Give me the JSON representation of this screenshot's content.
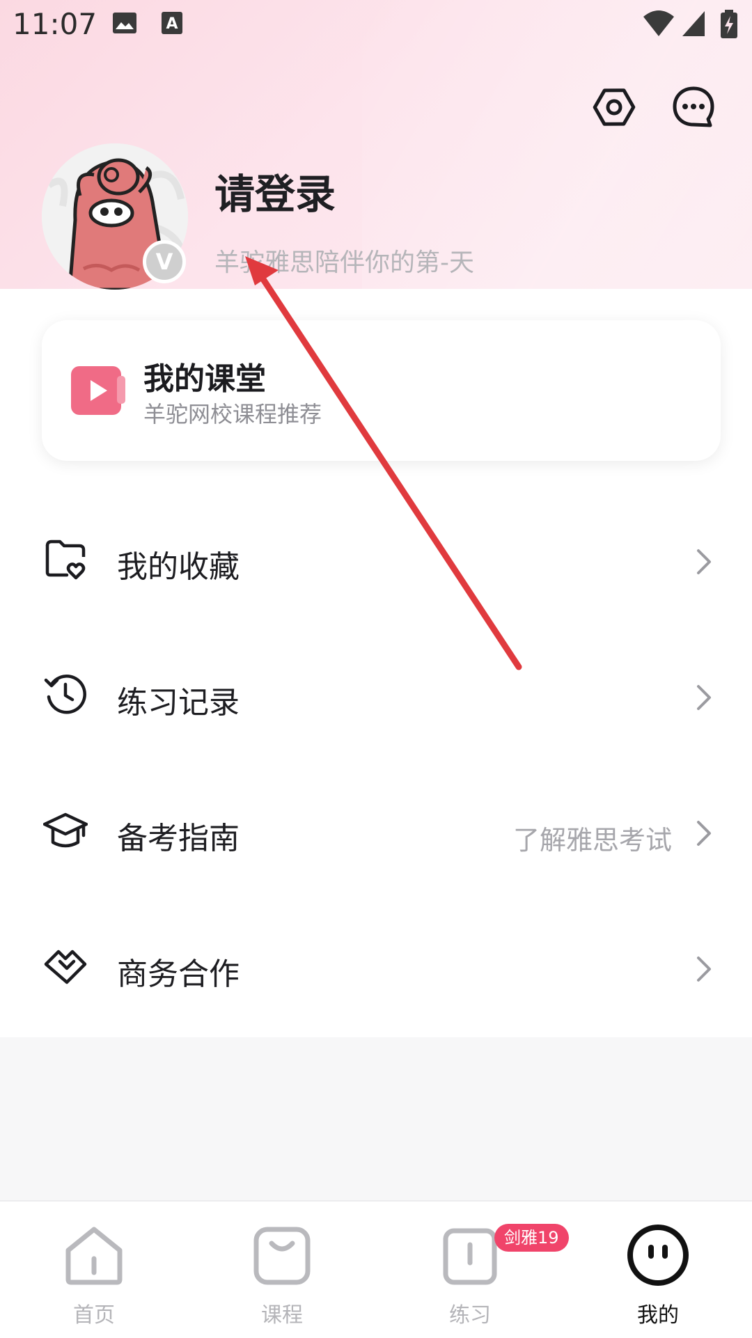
{
  "status_bar": {
    "time": "11:07",
    "icons": [
      "image-icon",
      "font-icon",
      "wifi-icon",
      "signal-icon",
      "battery-charging-icon"
    ]
  },
  "header": {
    "settings_icon": "settings-icon",
    "message_icon": "message-icon",
    "login_title": "请登录",
    "login_subtitle": "羊驼雅思陪伴你的第-天",
    "verified_mark": "V"
  },
  "classroom_card": {
    "title": "我的课堂",
    "subtitle": "羊驼网校课程推荐",
    "icon": "video-play-icon"
  },
  "menu": [
    {
      "label": "我的收藏",
      "hint": "",
      "icon": "folder-heart-icon"
    },
    {
      "label": "练习记录",
      "hint": "",
      "icon": "history-icon"
    },
    {
      "label": "备考指南",
      "hint": "了解雅思考试",
      "icon": "graduation-cap-icon"
    },
    {
      "label": "商务合作",
      "hint": "",
      "icon": "handshake-icon"
    }
  ],
  "tabbar": {
    "tabs": [
      {
        "label": "首页",
        "icon": "home-icon",
        "active": false
      },
      {
        "label": "课程",
        "icon": "course-bag-icon",
        "active": false
      },
      {
        "label": "练习",
        "icon": "practice-book-icon",
        "active": false,
        "badge": "剑雅19"
      },
      {
        "label": "我的",
        "icon": "profile-face-icon",
        "active": true
      }
    ]
  },
  "colors": {
    "header_pink": "#fbd9e2",
    "card_icon_pink": "#f06b86",
    "badge_red": "#f0446a",
    "annotation_arrow": "#e03a3e"
  }
}
